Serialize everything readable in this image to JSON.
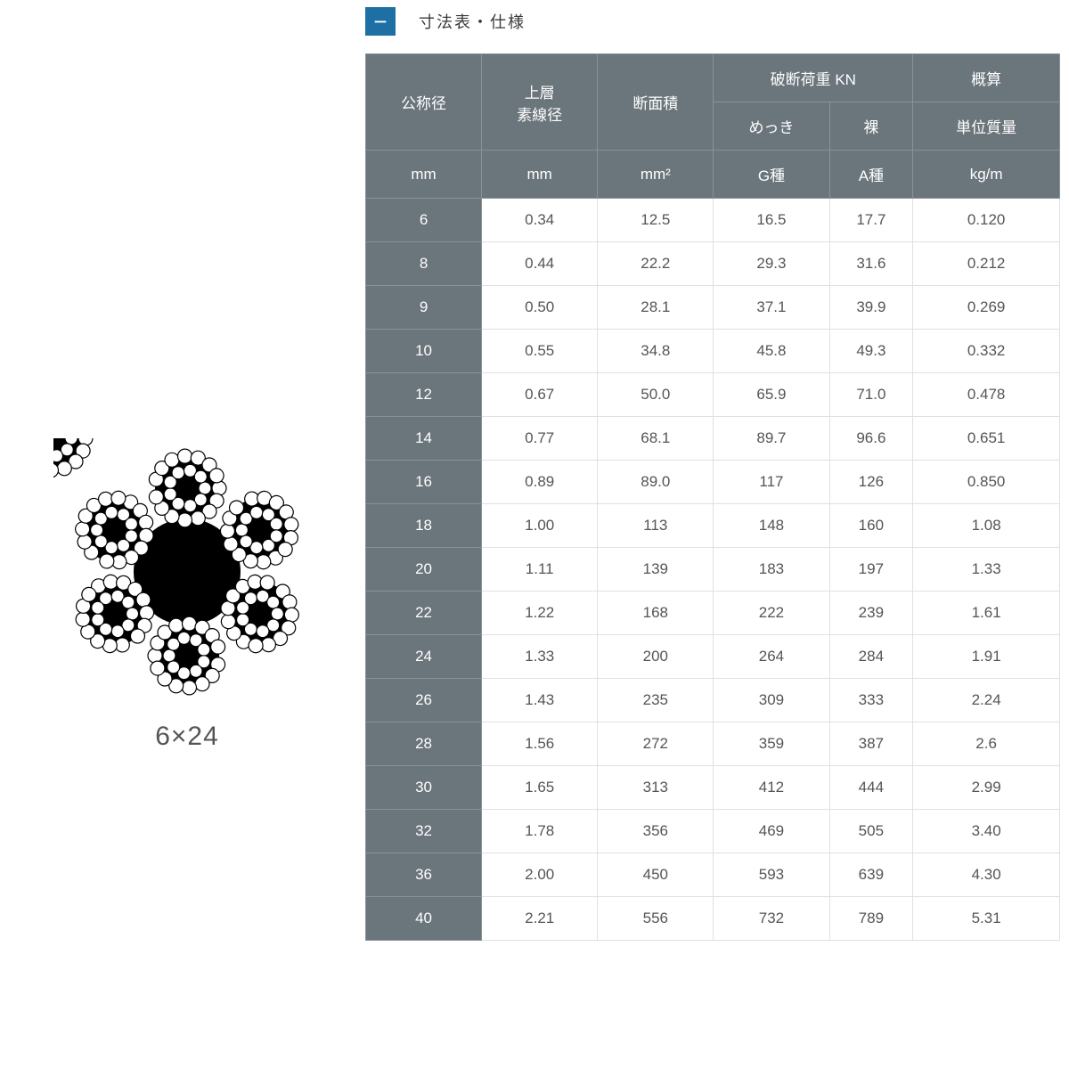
{
  "section": {
    "toggle_symbol": "−",
    "title": "寸法表・仕様"
  },
  "diagram": {
    "type_label": "6×24"
  },
  "table": {
    "header": {
      "nominal_dia": "公称径",
      "outer_wire_dia": "上層\n素線径",
      "cross_section": "断面積",
      "breaking_load": "破断荷重 KN",
      "breaking_plated": "めっき",
      "breaking_bare": "裸",
      "approx": "概算",
      "unit_mass": "単位質量"
    },
    "units": {
      "nominal_dia": "mm",
      "outer_wire_dia": "mm",
      "cross_section": "mm²",
      "breaking_plated": "G種",
      "breaking_bare": "A種",
      "unit_mass": "kg/m"
    },
    "rows": [
      {
        "d": "6",
        "w": "0.34",
        "a": "12.5",
        "g": "16.5",
        "b": "17.7",
        "m": "0.120"
      },
      {
        "d": "8",
        "w": "0.44",
        "a": "22.2",
        "g": "29.3",
        "b": "31.6",
        "m": "0.212"
      },
      {
        "d": "9",
        "w": "0.50",
        "a": "28.1",
        "g": "37.1",
        "b": "39.9",
        "m": "0.269"
      },
      {
        "d": "10",
        "w": "0.55",
        "a": "34.8",
        "g": "45.8",
        "b": "49.3",
        "m": "0.332"
      },
      {
        "d": "12",
        "w": "0.67",
        "a": "50.0",
        "g": "65.9",
        "b": "71.0",
        "m": "0.478"
      },
      {
        "d": "14",
        "w": "0.77",
        "a": "68.1",
        "g": "89.7",
        "b": "96.6",
        "m": "0.651"
      },
      {
        "d": "16",
        "w": "0.89",
        "a": "89.0",
        "g": "117",
        "b": "126",
        "m": "0.850"
      },
      {
        "d": "18",
        "w": "1.00",
        "a": "113",
        "g": "148",
        "b": "160",
        "m": "1.08"
      },
      {
        "d": "20",
        "w": "1.11",
        "a": "139",
        "g": "183",
        "b": "197",
        "m": "1.33"
      },
      {
        "d": "22",
        "w": "1.22",
        "a": "168",
        "g": "222",
        "b": "239",
        "m": "1.61"
      },
      {
        "d": "24",
        "w": "1.33",
        "a": "200",
        "g": "264",
        "b": "284",
        "m": "1.91"
      },
      {
        "d": "26",
        "w": "1.43",
        "a": "235",
        "g": "309",
        "b": "333",
        "m": "2.24"
      },
      {
        "d": "28",
        "w": "1.56",
        "a": "272",
        "g": "359",
        "b": "387",
        "m": "2.6"
      },
      {
        "d": "30",
        "w": "1.65",
        "a": "313",
        "g": "412",
        "b": "444",
        "m": "2.99"
      },
      {
        "d": "32",
        "w": "1.78",
        "a": "356",
        "g": "469",
        "b": "505",
        "m": "3.40"
      },
      {
        "d": "36",
        "w": "2.00",
        "a": "450",
        "g": "593",
        "b": "639",
        "m": "4.30"
      },
      {
        "d": "40",
        "w": "2.21",
        "a": "556",
        "g": "732",
        "b": "789",
        "m": "5.31"
      }
    ]
  }
}
